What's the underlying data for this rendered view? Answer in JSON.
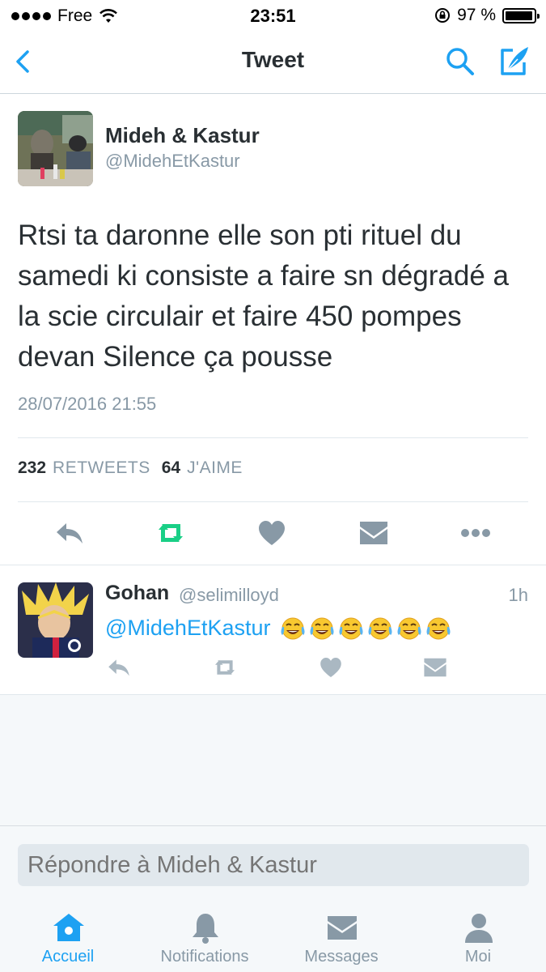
{
  "status_bar": {
    "carrier": "Free",
    "time": "23:51",
    "battery_text": "97 %",
    "battery_level": 0.97
  },
  "nav": {
    "title": "Tweet",
    "accent_color": "#1da1f2"
  },
  "tweet": {
    "author_name": "Mideh & Kastur",
    "author_handle": "@MidehEtKastur",
    "text": "Rtsi ta daronne elle son pti rituel du samedi ki consiste a faire sn dégradé a la scie circulair et faire 450 pompes devan Silence ça pousse",
    "date": "28/07/2016 21:55",
    "retweets_count": "232",
    "retweets_label": "RETWEETS",
    "likes_count": "64",
    "likes_label": "J'AIME",
    "retweet_color": "#19cf86"
  },
  "reply": {
    "author_name": "Gohan",
    "author_handle": "@selimilloyd",
    "time": "1h",
    "mention": "@MidehEtKastur",
    "emoji_name": "face-with-tears-of-joy",
    "emoji_count": 6
  },
  "reply_box": {
    "placeholder": "Répondre à Mideh & Kastur"
  },
  "tabbar": {
    "tabs": [
      {
        "label": "Accueil",
        "icon": "home-icon",
        "active": true
      },
      {
        "label": "Notifications",
        "icon": "bell-icon",
        "active": false
      },
      {
        "label": "Messages",
        "icon": "envelope-icon",
        "active": false
      },
      {
        "label": "Moi",
        "icon": "person-icon",
        "active": false
      }
    ]
  }
}
